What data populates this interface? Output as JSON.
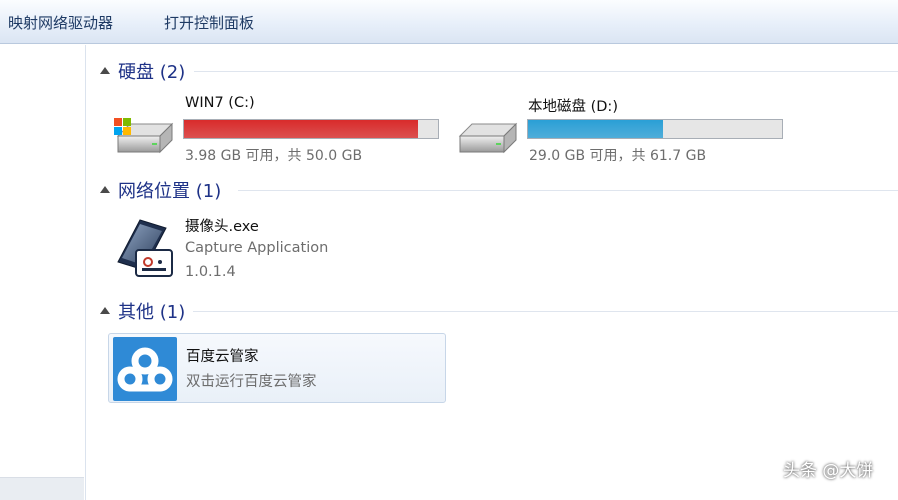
{
  "toolbar": {
    "map_drive": "映射网络驱动器",
    "control_panel": "打开控制面板"
  },
  "groups": {
    "hard_disks": {
      "title": "硬盘 (2)"
    },
    "network": {
      "title": "网络位置 (1)"
    },
    "other": {
      "title": "其他 (1)"
    }
  },
  "drives": [
    {
      "name": "WIN7 (C:)",
      "info": "3.98 GB 可用，共 50.0 GB",
      "used_fraction": 0.92,
      "bar_color": "#d92b2b",
      "icon": "windows-drive-icon"
    },
    {
      "name": "本地磁盘 (D:)",
      "info": "29.0 GB 可用，共 61.7 GB",
      "used_fraction": 0.53,
      "bar_color": "#2a9fd6",
      "icon": "hard-drive-icon"
    }
  ],
  "network_item": {
    "title": "摄像头.exe",
    "description": "Capture Application",
    "version": "1.0.1.4",
    "icon": "camera-app-icon"
  },
  "other_item": {
    "title": "百度云管家",
    "description": "双击运行百度云管家",
    "icon": "baidu-cloud-icon"
  },
  "watermark": "头条 @大饼"
}
